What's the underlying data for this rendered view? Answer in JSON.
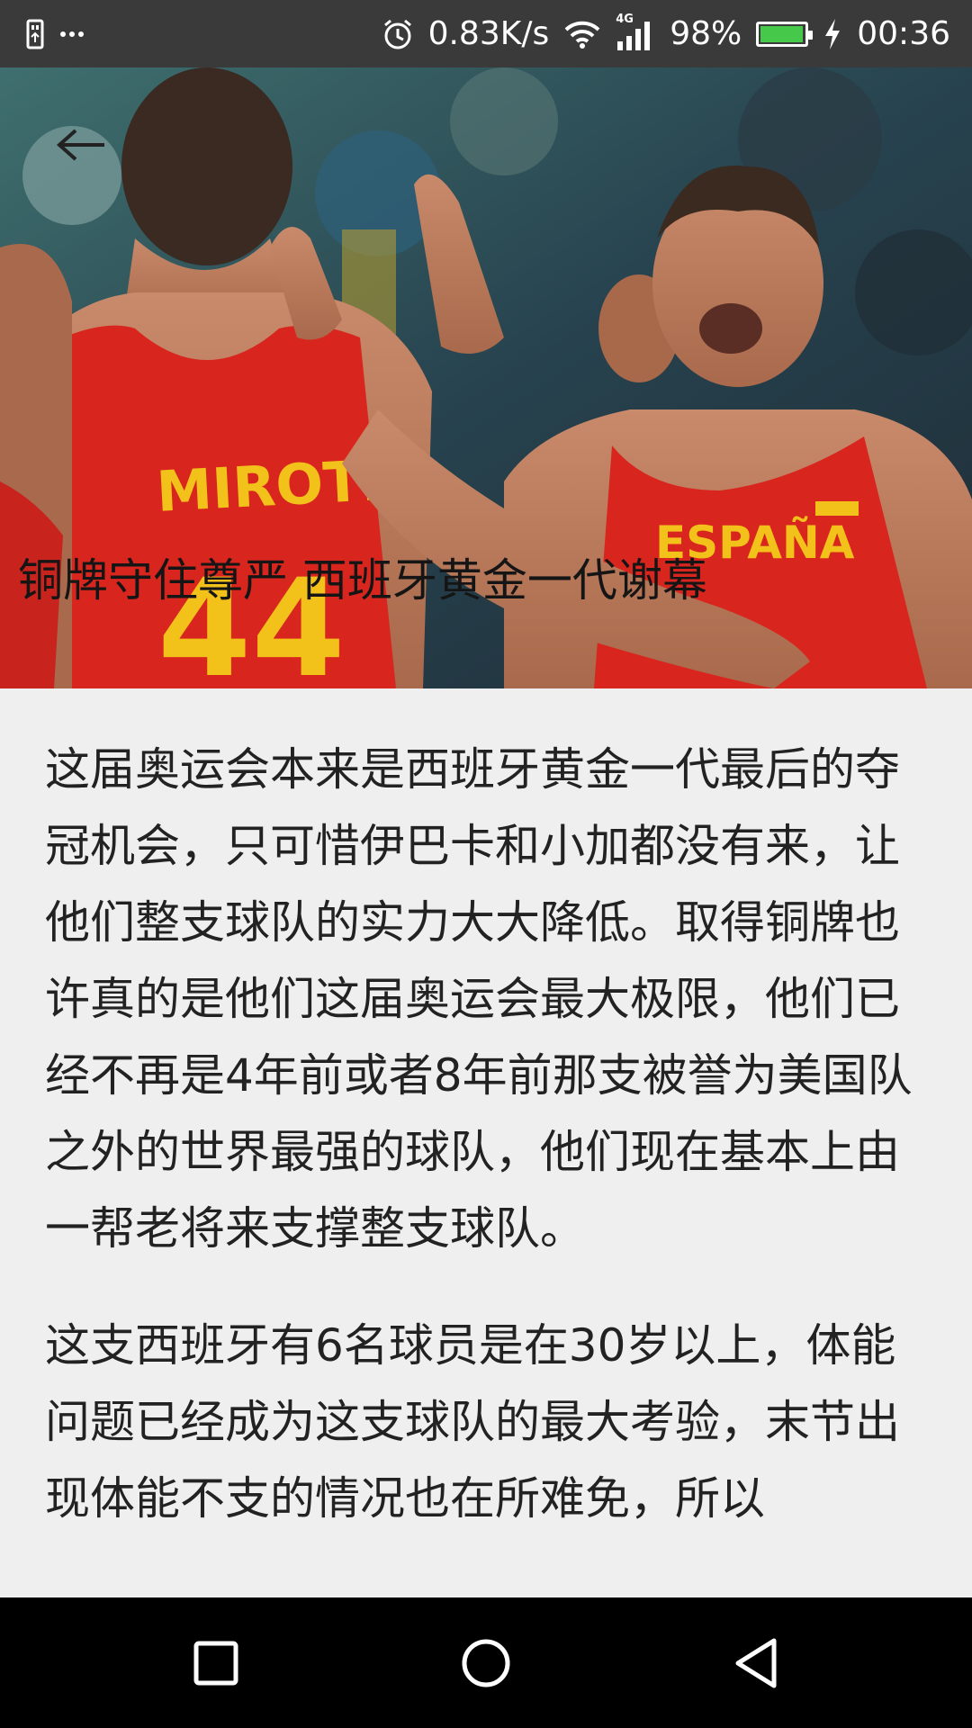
{
  "status_bar": {
    "left_icons": [
      "usb-icon",
      "more-dots-icon"
    ],
    "alarm_icon": "alarm-icon",
    "net_speed": "0.83K/s",
    "wifi_icon": "wifi-icon",
    "signal_icon": "signal-4g-icon",
    "signal_label": "4G",
    "battery_percent": "98%",
    "battery_level": 0.98,
    "charging_icon": "lightning-icon",
    "time": "00:36"
  },
  "hero": {
    "back_icon": "back-arrow-icon",
    "title": "铜牌守住尊严  西班牙黄金一代谢幕",
    "jersey_name": "MIROTIC",
    "jersey_number": "44",
    "jersey_text_right": "ESPAÑA",
    "colors": {
      "jersey_red": "#d8261f",
      "jersey_yellow": "#f2c21b"
    }
  },
  "article": {
    "paragraphs": [
      "这届奥运会本来是西班牙黄金一代最后的夺冠机会，只可惜伊巴卡和小加都没有来，让他们整支球队的实力大大降低。取得铜牌也许真的是他们这届奥运会最大极限，他们已经不再是4年前或者8年前那支被誉为美国队之外的世界最强的球队，他们现在基本上由一帮老将来支撑整支球队。",
      "这支西班牙有6名球员是在30岁以上，体能问题已经成为这支球队的最大考验，末节出现体能不支的情况也在所难免，所以"
    ]
  },
  "nav_bar": {
    "recents_icon": "square-recents-icon",
    "home_icon": "circle-home-icon",
    "back_icon": "triangle-back-icon"
  }
}
